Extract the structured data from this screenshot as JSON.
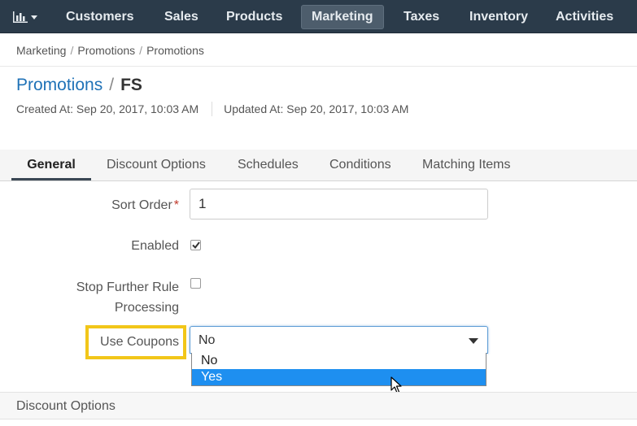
{
  "nav": {
    "items": [
      {
        "label": "Customers"
      },
      {
        "label": "Sales"
      },
      {
        "label": "Products"
      },
      {
        "label": "Marketing",
        "active": true
      },
      {
        "label": "Taxes"
      },
      {
        "label": "Inventory"
      },
      {
        "label": "Activities"
      }
    ]
  },
  "breadcrumb": [
    "Marketing",
    "Promotions",
    "Promotions"
  ],
  "page": {
    "title_link": "Promotions",
    "title_sep": "/",
    "title_current": "FS",
    "created": "Created At: Sep 20, 2017, 10:03 AM",
    "updated": "Updated At: Sep 20, 2017, 10:03 AM"
  },
  "tabs": [
    {
      "label": "General",
      "active": true
    },
    {
      "label": "Discount Options"
    },
    {
      "label": "Schedules"
    },
    {
      "label": "Conditions"
    },
    {
      "label": "Matching Items"
    }
  ],
  "form": {
    "sort_order": {
      "label": "Sort Order",
      "required_mark": "*",
      "value": "1"
    },
    "enabled": {
      "label": "Enabled",
      "checked": true
    },
    "stop_rule": {
      "label_line1": "Stop Further Rule",
      "label_line2": "Processing",
      "checked": false
    },
    "use_coupons": {
      "label": "Use Coupons",
      "value": "No",
      "options": [
        "No",
        "Yes"
      ],
      "hovered_option": "Yes"
    }
  },
  "section": {
    "title": "Discount Options"
  },
  "colors": {
    "nav_bg": "#2b3b4a",
    "link": "#1f72b7",
    "highlight": "#f2c619",
    "option_selected": "#1e8ff0"
  }
}
